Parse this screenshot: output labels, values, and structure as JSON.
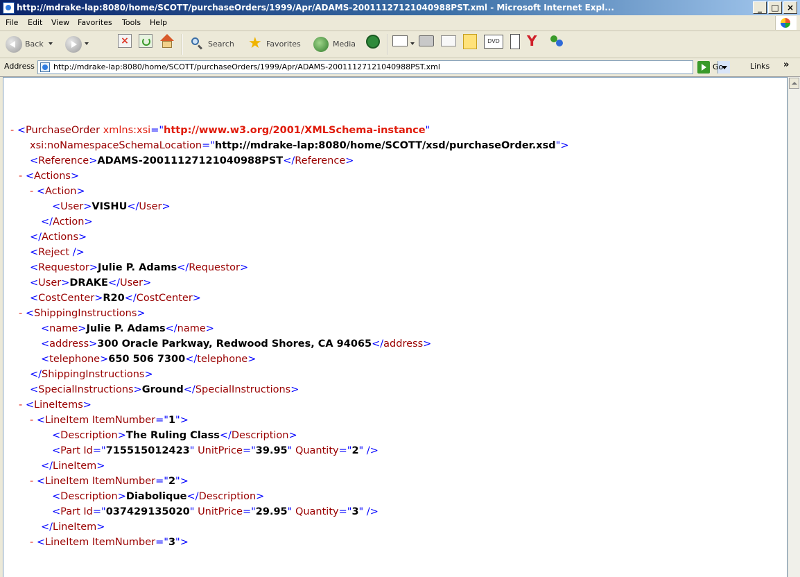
{
  "window": {
    "title": "http://mdrake-lap:8080/home/SCOTT/purchaseOrders/1999/Apr/ADAMS-20011127121040988PST.xml - Microsoft Internet Expl...",
    "min": "_",
    "max": "□",
    "close": "×"
  },
  "menu": {
    "items": [
      "File",
      "Edit",
      "View",
      "Favorites",
      "Tools",
      "Help"
    ]
  },
  "toolbar": {
    "back": "Back",
    "search": "Search",
    "favorites": "Favorites",
    "media": "Media",
    "dvd_label": "DVD"
  },
  "address": {
    "label": "Address",
    "url": "http://mdrake-lap:8080/home/SCOTT/purchaseOrders/1999/Apr/ADAMS-20011127121040988PST.xml",
    "go": "Go",
    "links": "Links",
    "links_chevron": "»"
  },
  "xml": {
    "syntax": {
      "minus": "-",
      "lt": "<",
      "lt_close": "</",
      "gt": ">",
      "self_close": " />",
      "eq": "=",
      "q": "\"",
      "sp": " "
    },
    "root": {
      "name": "PurchaseOrder",
      "ns_attr": "xmlns:xsi",
      "ns_value": "http://www.w3.org/2001/XMLSchema-instance",
      "loc_attr": "xsi:noNamespaceSchemaLocation",
      "loc_value": "http://mdrake-lap:8080/home/SCOTT/xsd/purchaseOrder.xsd"
    },
    "reference": {
      "tag": "Reference",
      "value": "ADAMS-20011127121040988PST"
    },
    "actions": {
      "tag": "Actions",
      "action_tag": "Action",
      "user_tag": "User",
      "user": "VISHU"
    },
    "reject": {
      "tag": "Reject"
    },
    "requestor": {
      "tag": "Requestor",
      "value": "Julie P. Adams"
    },
    "user": {
      "tag": "User",
      "value": "DRAKE"
    },
    "cost_center": {
      "tag": "CostCenter",
      "value": "R20"
    },
    "shipping": {
      "tag": "ShippingInstructions",
      "name_tag": "name",
      "name": "Julie P. Adams",
      "address_tag": "address",
      "address": "300 Oracle Parkway, Redwood Shores, CA 94065",
      "telephone_tag": "telephone",
      "telephone": "650 506 7300"
    },
    "special": {
      "tag": "SpecialInstructions",
      "value": "Ground"
    },
    "line_items": {
      "tag": "LineItems",
      "item_tag": "LineItem",
      "item_attr": "ItemNumber",
      "desc_tag": "Description",
      "part_tag": "Part",
      "id_attr": "Id",
      "price_attr": "UnitPrice",
      "qty_attr": "Quantity",
      "items": [
        {
          "number": "1",
          "description": "The Ruling Class",
          "id": "715515012423",
          "price": "39.95",
          "qty": "2"
        },
        {
          "number": "2",
          "description": "Diabolique",
          "id": "037429135020",
          "price": "29.95",
          "qty": "3"
        },
        {
          "number": "3"
        }
      ]
    }
  }
}
